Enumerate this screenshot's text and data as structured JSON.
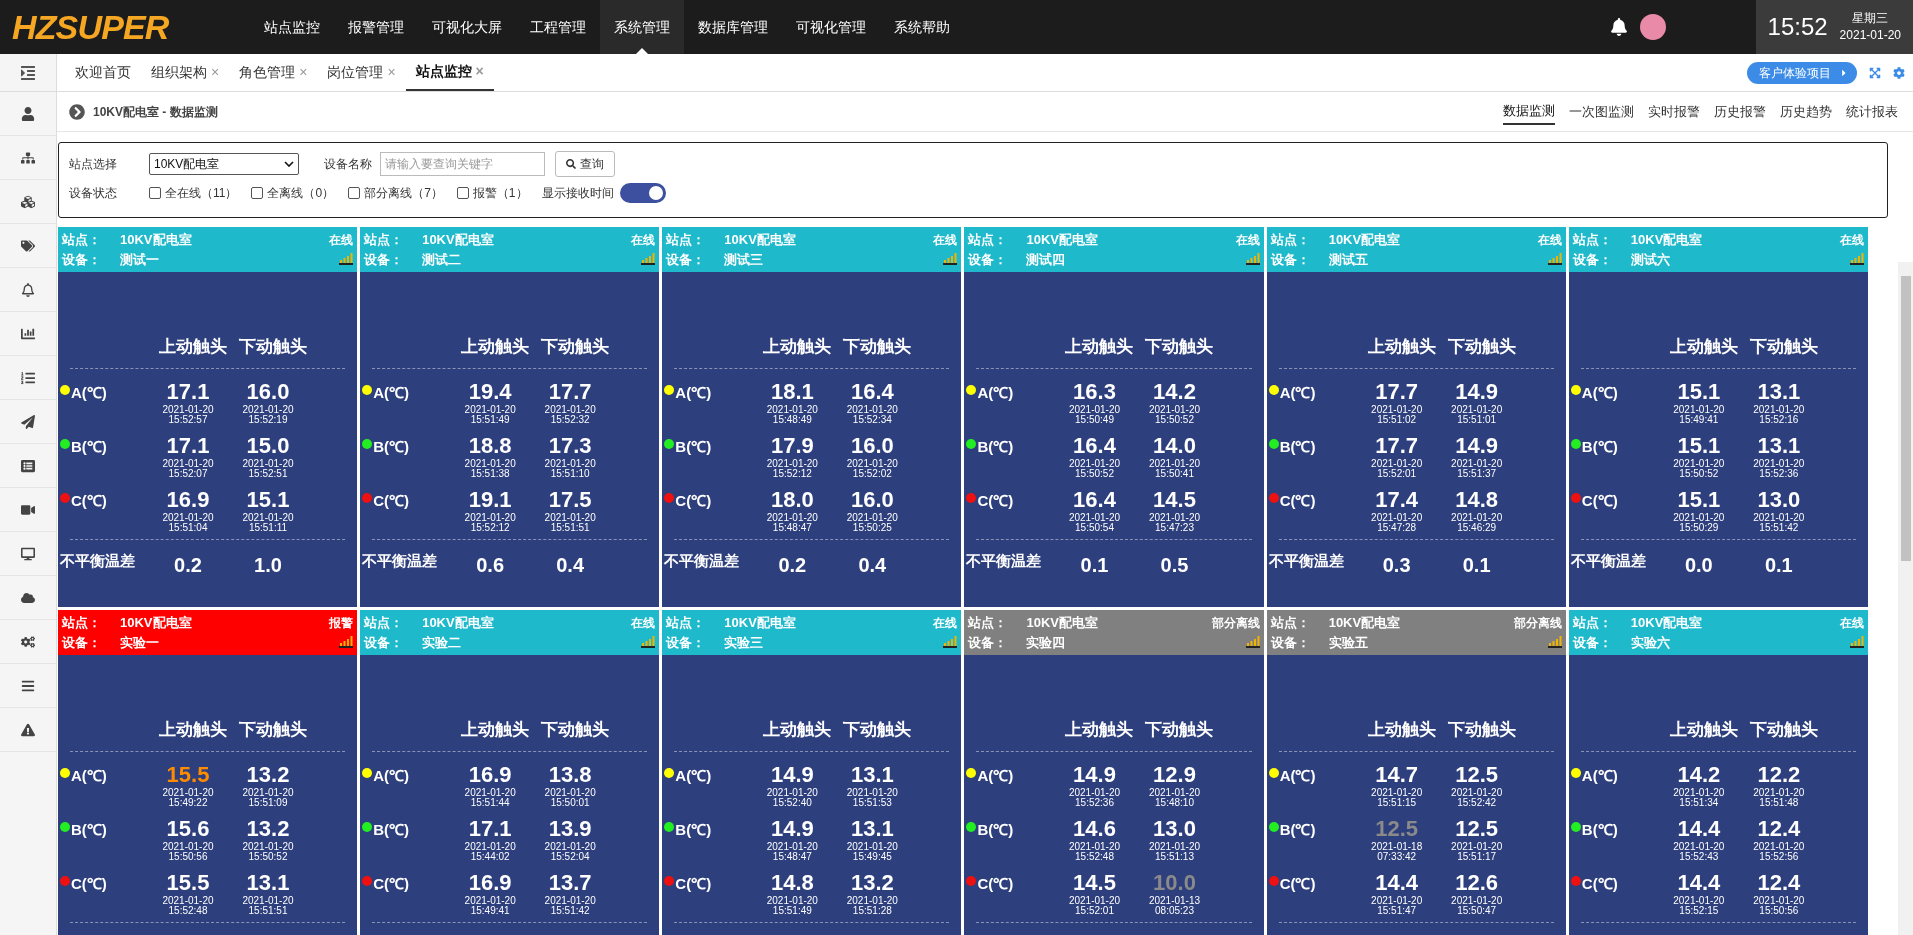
{
  "logo": "HZSUPER",
  "nav": [
    {
      "label": "站点监控",
      "selected": false
    },
    {
      "label": "报警管理",
      "selected": false
    },
    {
      "label": "可视化大屏",
      "selected": false
    },
    {
      "label": "工程管理",
      "selected": false
    },
    {
      "label": "系统管理",
      "selected": true
    },
    {
      "label": "数据库管理",
      "selected": false
    },
    {
      "label": "可视化管理",
      "selected": false
    },
    {
      "label": "系统帮助",
      "selected": false
    }
  ],
  "clock": {
    "time": "15:52",
    "weekday": "星期三",
    "date": "2021-01-20"
  },
  "tabs": [
    {
      "label": "欢迎首页",
      "closable": false,
      "selected": false
    },
    {
      "label": "组织架构",
      "closable": true,
      "selected": false
    },
    {
      "label": "角色管理",
      "closable": true,
      "selected": false
    },
    {
      "label": "岗位管理",
      "closable": true,
      "selected": false
    },
    {
      "label": "站点监控",
      "closable": true,
      "selected": true
    }
  ],
  "tab_close": "×",
  "demo_button": "客户体验项目",
  "breadcrumb": "10KV配电室 - 数据监测",
  "view_tabs": [
    {
      "label": "数据监测",
      "selected": true
    },
    {
      "label": "一次图监测",
      "selected": false
    },
    {
      "label": "实时报警",
      "selected": false
    },
    {
      "label": "历史报警",
      "selected": false
    },
    {
      "label": "历史趋势",
      "selected": false
    },
    {
      "label": "统计报表",
      "selected": false
    }
  ],
  "filter": {
    "station_label": "站点选择",
    "station_value": "10KV配电室",
    "device_label": "设备名称",
    "device_placeholder": "请输入要查询关键字",
    "query_button": "查询",
    "status_label": "设备状态",
    "statuses": [
      {
        "label": "全在线（11）",
        "checked": false
      },
      {
        "label": "全离线（0）",
        "checked": false
      },
      {
        "label": "部分离线（7）",
        "checked": false
      },
      {
        "label": "报警（1）",
        "checked": false
      }
    ],
    "show_time_label": "显示接收时间",
    "show_time_on": true
  },
  "cards": [
    {
      "station_label": "站点：",
      "station": "10KV配电室",
      "device_label": "设备：",
      "device": "测试一",
      "status": "在线",
      "kind": "online",
      "columns": [
        "上动触头",
        "下动触头"
      ],
      "rows": [
        {
          "label": "A(℃)",
          "color": "#ffff00",
          "cells": [
            {
              "value": "17.1",
              "date": "2021-01-20",
              "time": "15:52:57",
              "kind": "normal"
            },
            {
              "value": "16.0",
              "date": "2021-01-20",
              "time": "15:52:19",
              "kind": "normal"
            }
          ]
        },
        {
          "label": "B(℃)",
          "color": "#22ee22",
          "cells": [
            {
              "value": "17.1",
              "date": "2021-01-20",
              "time": "15:52:07",
              "kind": "normal"
            },
            {
              "value": "15.0",
              "date": "2021-01-20",
              "time": "15:52:51",
              "kind": "normal"
            }
          ]
        },
        {
          "label": "C(℃)",
          "color": "#ee1111",
          "cells": [
            {
              "value": "16.9",
              "date": "2021-01-20",
              "time": "15:51:04",
              "kind": "normal"
            },
            {
              "value": "15.1",
              "date": "2021-01-20",
              "time": "15:51:11",
              "kind": "normal"
            }
          ]
        }
      ],
      "imbalance": {
        "label": "不平衡温差",
        "values": [
          "0.2",
          "1.0"
        ]
      }
    },
    {
      "station_label": "站点：",
      "station": "10KV配电室",
      "device_label": "设备：",
      "device": "测试二",
      "status": "在线",
      "kind": "online",
      "columns": [
        "上动触头",
        "下动触头"
      ],
      "rows": [
        {
          "label": "A(℃)",
          "color": "#ffff00",
          "cells": [
            {
              "value": "19.4",
              "date": "2021-01-20",
              "time": "15:51:49",
              "kind": "normal"
            },
            {
              "value": "17.7",
              "date": "2021-01-20",
              "time": "15:52:32",
              "kind": "normal"
            }
          ]
        },
        {
          "label": "B(℃)",
          "color": "#22ee22",
          "cells": [
            {
              "value": "18.8",
              "date": "2021-01-20",
              "time": "15:51:38",
              "kind": "normal"
            },
            {
              "value": "17.3",
              "date": "2021-01-20",
              "time": "15:51:10",
              "kind": "normal"
            }
          ]
        },
        {
          "label": "C(℃)",
          "color": "#ee1111",
          "cells": [
            {
              "value": "19.1",
              "date": "2021-01-20",
              "time": "15:52:12",
              "kind": "normal"
            },
            {
              "value": "17.5",
              "date": "2021-01-20",
              "time": "15:51:51",
              "kind": "normal"
            }
          ]
        }
      ],
      "imbalance": {
        "label": "不平衡温差",
        "values": [
          "0.6",
          "0.4"
        ]
      }
    },
    {
      "station_label": "站点：",
      "station": "10KV配电室",
      "device_label": "设备：",
      "device": "测试三",
      "status": "在线",
      "kind": "online",
      "columns": [
        "上动触头",
        "下动触头"
      ],
      "rows": [
        {
          "label": "A(℃)",
          "color": "#ffff00",
          "cells": [
            {
              "value": "18.1",
              "date": "2021-01-20",
              "time": "15:48:49",
              "kind": "normal"
            },
            {
              "value": "16.4",
              "date": "2021-01-20",
              "time": "15:52:34",
              "kind": "normal"
            }
          ]
        },
        {
          "label": "B(℃)",
          "color": "#22ee22",
          "cells": [
            {
              "value": "17.9",
              "date": "2021-01-20",
              "time": "15:52:12",
              "kind": "normal"
            },
            {
              "value": "16.0",
              "date": "2021-01-20",
              "time": "15:52:02",
              "kind": "normal"
            }
          ]
        },
        {
          "label": "C(℃)",
          "color": "#ee1111",
          "cells": [
            {
              "value": "18.0",
              "date": "2021-01-20",
              "time": "15:48:47",
              "kind": "normal"
            },
            {
              "value": "16.0",
              "date": "2021-01-20",
              "time": "15:50:25",
              "kind": "normal"
            }
          ]
        }
      ],
      "imbalance": {
        "label": "不平衡温差",
        "values": [
          "0.2",
          "0.4"
        ]
      }
    },
    {
      "station_label": "站点：",
      "station": "10KV配电室",
      "device_label": "设备：",
      "device": "测试四",
      "status": "在线",
      "kind": "online",
      "columns": [
        "上动触头",
        "下动触头"
      ],
      "rows": [
        {
          "label": "A(℃)",
          "color": "#ffff00",
          "cells": [
            {
              "value": "16.3",
              "date": "2021-01-20",
              "time": "15:50:49",
              "kind": "normal"
            },
            {
              "value": "14.2",
              "date": "2021-01-20",
              "time": "15:50:52",
              "kind": "normal"
            }
          ]
        },
        {
          "label": "B(℃)",
          "color": "#22ee22",
          "cells": [
            {
              "value": "16.4",
              "date": "2021-01-20",
              "time": "15:50:52",
              "kind": "normal"
            },
            {
              "value": "14.0",
              "date": "2021-01-20",
              "time": "15:50:41",
              "kind": "normal"
            }
          ]
        },
        {
          "label": "C(℃)",
          "color": "#ee1111",
          "cells": [
            {
              "value": "16.4",
              "date": "2021-01-20",
              "time": "15:50:54",
              "kind": "normal"
            },
            {
              "value": "14.5",
              "date": "2021-01-20",
              "time": "15:47:23",
              "kind": "normal"
            }
          ]
        }
      ],
      "imbalance": {
        "label": "不平衡温差",
        "values": [
          "0.1",
          "0.5"
        ]
      }
    },
    {
      "station_label": "站点：",
      "station": "10KV配电室",
      "device_label": "设备：",
      "device": "测试五",
      "status": "在线",
      "kind": "online",
      "columns": [
        "上动触头",
        "下动触头"
      ],
      "rows": [
        {
          "label": "A(℃)",
          "color": "#ffff00",
          "cells": [
            {
              "value": "17.7",
              "date": "2021-01-20",
              "time": "15:51:02",
              "kind": "normal"
            },
            {
              "value": "14.9",
              "date": "2021-01-20",
              "time": "15:51:01",
              "kind": "normal"
            }
          ]
        },
        {
          "label": "B(℃)",
          "color": "#22ee22",
          "cells": [
            {
              "value": "17.7",
              "date": "2021-01-20",
              "time": "15:52:01",
              "kind": "normal"
            },
            {
              "value": "14.9",
              "date": "2021-01-20",
              "time": "15:51:37",
              "kind": "normal"
            }
          ]
        },
        {
          "label": "C(℃)",
          "color": "#ee1111",
          "cells": [
            {
              "value": "17.4",
              "date": "2021-01-20",
              "time": "15:47:28",
              "kind": "normal"
            },
            {
              "value": "14.8",
              "date": "2021-01-20",
              "time": "15:46:29",
              "kind": "normal"
            }
          ]
        }
      ],
      "imbalance": {
        "label": "不平衡温差",
        "values": [
          "0.3",
          "0.1"
        ]
      }
    },
    {
      "station_label": "站点：",
      "station": "10KV配电室",
      "device_label": "设备：",
      "device": "测试六",
      "status": "在线",
      "kind": "online",
      "columns": [
        "上动触头",
        "下动触头"
      ],
      "rows": [
        {
          "label": "A(℃)",
          "color": "#ffff00",
          "cells": [
            {
              "value": "15.1",
              "date": "2021-01-20",
              "time": "15:49:41",
              "kind": "normal"
            },
            {
              "value": "13.1",
              "date": "2021-01-20",
              "time": "15:52:16",
              "kind": "normal"
            }
          ]
        },
        {
          "label": "B(℃)",
          "color": "#22ee22",
          "cells": [
            {
              "value": "15.1",
              "date": "2021-01-20",
              "time": "15:50:52",
              "kind": "normal"
            },
            {
              "value": "13.1",
              "date": "2021-01-20",
              "time": "15:52:36",
              "kind": "normal"
            }
          ]
        },
        {
          "label": "C(℃)",
          "color": "#ee1111",
          "cells": [
            {
              "value": "15.1",
              "date": "2021-01-20",
              "time": "15:50:29",
              "kind": "normal"
            },
            {
              "value": "13.0",
              "date": "2021-01-20",
              "time": "15:51:42",
              "kind": "normal"
            }
          ]
        }
      ],
      "imbalance": {
        "label": "不平衡温差",
        "values": [
          "0.0",
          "0.1"
        ]
      }
    },
    {
      "station_label": "站点：",
      "station": "10KV配电室",
      "device_label": "设备：",
      "device": "实验一",
      "status": "报警",
      "kind": "alarm",
      "columns": [
        "上动触头",
        "下动触头"
      ],
      "rows": [
        {
          "label": "A(℃)",
          "color": "#ffff00",
          "cells": [
            {
              "value": "15.5",
              "date": "2021-01-20",
              "time": "15:49:22",
              "kind": "alarm"
            },
            {
              "value": "13.2",
              "date": "2021-01-20",
              "time": "15:51:09",
              "kind": "normal"
            }
          ]
        },
        {
          "label": "B(℃)",
          "color": "#22ee22",
          "cells": [
            {
              "value": "15.6",
              "date": "2021-01-20",
              "time": "15:50:56",
              "kind": "normal"
            },
            {
              "value": "13.2",
              "date": "2021-01-20",
              "time": "15:50:52",
              "kind": "normal"
            }
          ]
        },
        {
          "label": "C(℃)",
          "color": "#ee1111",
          "cells": [
            {
              "value": "15.5",
              "date": "2021-01-20",
              "time": "15:52:48",
              "kind": "normal"
            },
            {
              "value": "13.1",
              "date": "2021-01-20",
              "time": "15:51:51",
              "kind": "normal"
            }
          ]
        }
      ]
    },
    {
      "station_label": "站点：",
      "station": "10KV配电室",
      "device_label": "设备：",
      "device": "实验二",
      "status": "在线",
      "kind": "online",
      "columns": [
        "上动触头",
        "下动触头"
      ],
      "rows": [
        {
          "label": "A(℃)",
          "color": "#ffff00",
          "cells": [
            {
              "value": "16.9",
              "date": "2021-01-20",
              "time": "15:51:44",
              "kind": "normal"
            },
            {
              "value": "13.8",
              "date": "2021-01-20",
              "time": "15:50:01",
              "kind": "normal"
            }
          ]
        },
        {
          "label": "B(℃)",
          "color": "#22ee22",
          "cells": [
            {
              "value": "17.1",
              "date": "2021-01-20",
              "time": "15:44:02",
              "kind": "normal"
            },
            {
              "value": "13.9",
              "date": "2021-01-20",
              "time": "15:52:04",
              "kind": "normal"
            }
          ]
        },
        {
          "label": "C(℃)",
          "color": "#ee1111",
          "cells": [
            {
              "value": "16.9",
              "date": "2021-01-20",
              "time": "15:49:41",
              "kind": "normal"
            },
            {
              "value": "13.7",
              "date": "2021-01-20",
              "time": "15:51:42",
              "kind": "normal"
            }
          ]
        }
      ]
    },
    {
      "station_label": "站点：",
      "station": "10KV配电室",
      "device_label": "设备：",
      "device": "实验三",
      "status": "在线",
      "kind": "online",
      "columns": [
        "上动触头",
        "下动触头"
      ],
      "rows": [
        {
          "label": "A(℃)",
          "color": "#ffff00",
          "cells": [
            {
              "value": "14.9",
              "date": "2021-01-20",
              "time": "15:52:40",
              "kind": "normal"
            },
            {
              "value": "13.1",
              "date": "2021-01-20",
              "time": "15:51:53",
              "kind": "normal"
            }
          ]
        },
        {
          "label": "B(℃)",
          "color": "#22ee22",
          "cells": [
            {
              "value": "14.9",
              "date": "2021-01-20",
              "time": "15:48:47",
              "kind": "normal"
            },
            {
              "value": "13.1",
              "date": "2021-01-20",
              "time": "15:49:45",
              "kind": "normal"
            }
          ]
        },
        {
          "label": "C(℃)",
          "color": "#ee1111",
          "cells": [
            {
              "value": "14.8",
              "date": "2021-01-20",
              "time": "15:51:49",
              "kind": "normal"
            },
            {
              "value": "13.2",
              "date": "2021-01-20",
              "time": "15:51:28",
              "kind": "normal"
            }
          ]
        }
      ]
    },
    {
      "station_label": "站点：",
      "station": "10KV配电室",
      "device_label": "设备：",
      "device": "实验四",
      "status": "部分离线",
      "kind": "partial",
      "columns": [
        "上动触头",
        "下动触头"
      ],
      "rows": [
        {
          "label": "A(℃)",
          "color": "#ffff00",
          "cells": [
            {
              "value": "14.9",
              "date": "2021-01-20",
              "time": "15:52:36",
              "kind": "normal"
            },
            {
              "value": "12.9",
              "date": "2021-01-20",
              "time": "15:48:10",
              "kind": "normal"
            }
          ]
        },
        {
          "label": "B(℃)",
          "color": "#22ee22",
          "cells": [
            {
              "value": "14.6",
              "date": "2021-01-20",
              "time": "15:52:48",
              "kind": "normal"
            },
            {
              "value": "13.0",
              "date": "2021-01-20",
              "time": "15:51:13",
              "kind": "normal"
            }
          ]
        },
        {
          "label": "C(℃)",
          "color": "#ee1111",
          "cells": [
            {
              "value": "14.5",
              "date": "2021-01-20",
              "time": "15:52:01",
              "kind": "normal"
            },
            {
              "value": "10.0",
              "date": "2021-01-13",
              "time": "08:05:23",
              "kind": "stale"
            }
          ]
        }
      ]
    },
    {
      "station_label": "站点：",
      "station": "10KV配电室",
      "device_label": "设备：",
      "device": "实验五",
      "status": "部分离线",
      "kind": "partial",
      "columns": [
        "上动触头",
        "下动触头"
      ],
      "rows": [
        {
          "label": "A(℃)",
          "color": "#ffff00",
          "cells": [
            {
              "value": "14.7",
              "date": "2021-01-20",
              "time": "15:51:15",
              "kind": "normal"
            },
            {
              "value": "12.5",
              "date": "2021-01-20",
              "time": "15:52:42",
              "kind": "normal"
            }
          ]
        },
        {
          "label": "B(℃)",
          "color": "#22ee22",
          "cells": [
            {
              "value": "12.5",
              "date": "2021-01-18",
              "time": "07:33:42",
              "kind": "stale"
            },
            {
              "value": "12.5",
              "date": "2021-01-20",
              "time": "15:51:17",
              "kind": "normal"
            }
          ]
        },
        {
          "label": "C(℃)",
          "color": "#ee1111",
          "cells": [
            {
              "value": "14.4",
              "date": "2021-01-20",
              "time": "15:51:47",
              "kind": "normal"
            },
            {
              "value": "12.6",
              "date": "2021-01-20",
              "time": "15:50:47",
              "kind": "normal"
            }
          ]
        }
      ]
    },
    {
      "station_label": "站点：",
      "station": "10KV配电室",
      "device_label": "设备：",
      "device": "实验六",
      "status": "在线",
      "kind": "online",
      "columns": [
        "上动触头",
        "下动触头"
      ],
      "rows": [
        {
          "label": "A(℃)",
          "color": "#ffff00",
          "cells": [
            {
              "value": "14.2",
              "date": "2021-01-20",
              "time": "15:51:34",
              "kind": "normal"
            },
            {
              "value": "12.2",
              "date": "2021-01-20",
              "time": "15:51:48",
              "kind": "normal"
            }
          ]
        },
        {
          "label": "B(℃)",
          "color": "#22ee22",
          "cells": [
            {
              "value": "14.4",
              "date": "2021-01-20",
              "time": "15:52:43",
              "kind": "normal"
            },
            {
              "value": "12.4",
              "date": "2021-01-20",
              "time": "15:52:56",
              "kind": "normal"
            }
          ]
        },
        {
          "label": "C(℃)",
          "color": "#ee1111",
          "cells": [
            {
              "value": "14.4",
              "date": "2021-01-20",
              "time": "15:52:15",
              "kind": "normal"
            },
            {
              "value": "12.4",
              "date": "2021-01-20",
              "time": "15:50:56",
              "kind": "normal"
            }
          ]
        }
      ]
    }
  ]
}
